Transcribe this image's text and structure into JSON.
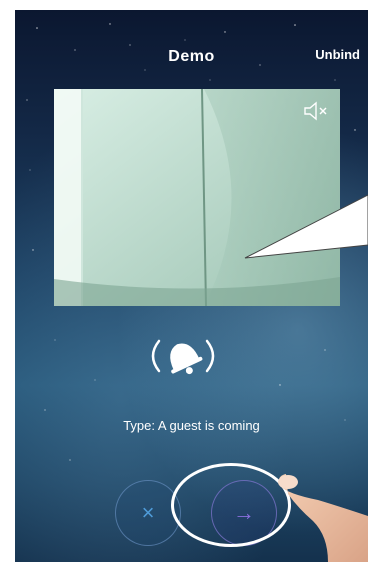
{
  "header": {
    "title": "Demo",
    "unbind_label": "Unbind"
  },
  "video": {
    "mute_icon": "speaker-muted-icon"
  },
  "alert": {
    "bell_icon": "bell-icon",
    "type_text": "Type:  A guest is coming"
  },
  "actions": {
    "decline_label": "×",
    "accept_label": "→"
  },
  "colors": {
    "decline": "#4f9bd8",
    "accept": "#8a6fe0",
    "highlight": "#ffffff"
  }
}
